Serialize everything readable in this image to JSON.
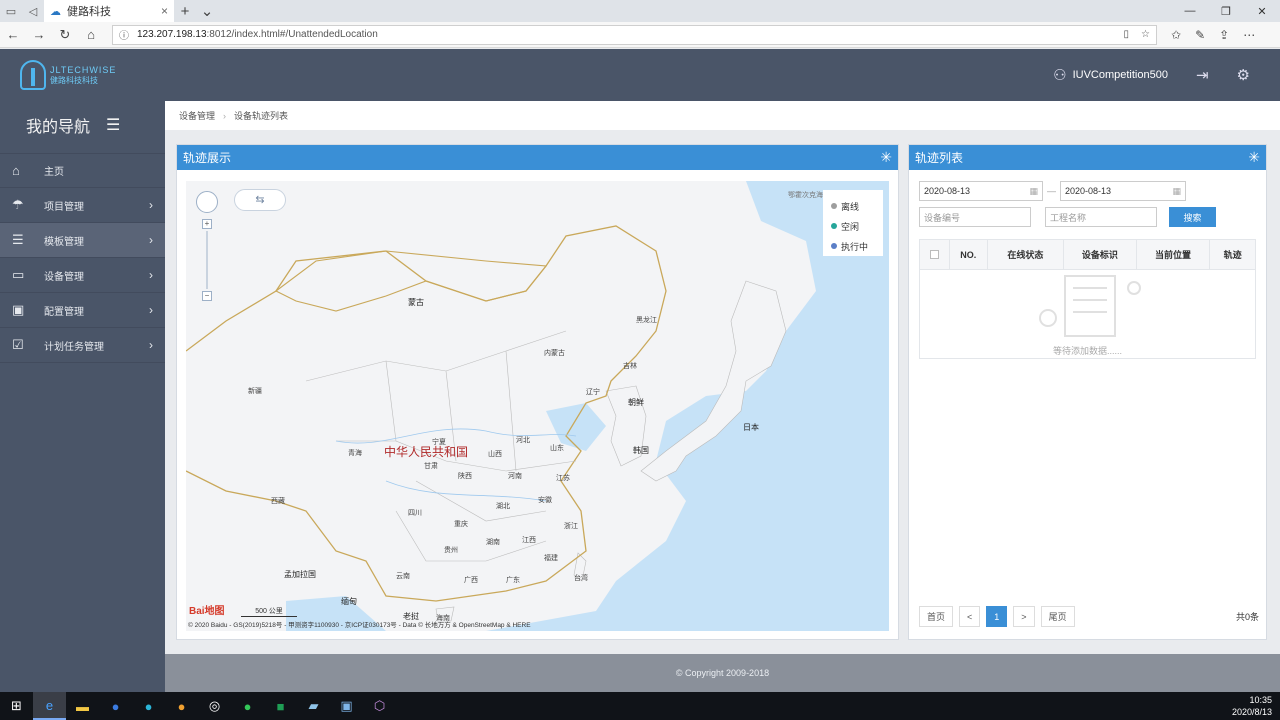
{
  "browser": {
    "tab_title": "健路科技",
    "url_host": "123.207.198.13",
    "url_rest": ":8012/index.html#/UnattendedLocation"
  },
  "header": {
    "logo_en": "JLTECHWISE",
    "logo_zh": "健路科技科技",
    "username": "IUVCompetition500"
  },
  "sidebar": {
    "title": "我的导航",
    "items": [
      {
        "label": "主页",
        "icon": "home-icon"
      },
      {
        "label": "项目管理",
        "icon": "project-icon"
      },
      {
        "label": "模板管理",
        "icon": "template-icon"
      },
      {
        "label": "设备管理",
        "icon": "device-icon"
      },
      {
        "label": "配置管理",
        "icon": "config-icon"
      },
      {
        "label": "计划任务管理",
        "icon": "task-icon"
      }
    ]
  },
  "breadcrumb": {
    "parent": "设备管理",
    "current": "设备轨迹列表"
  },
  "map_panel": {
    "title": "轨迹展示",
    "top_right_label": "鄂霍次克海",
    "legend": [
      {
        "label": "离线",
        "color": "#9e9e9e"
      },
      {
        "label": "空闲",
        "color": "#26a69a"
      },
      {
        "label": "执行中",
        "color": "#5b7fc7"
      }
    ],
    "labels": {
      "mongolia": "蒙古",
      "china": "中华人民共和国",
      "korea_n": "朝鲜",
      "korea_s": "韩国",
      "japan": "日本",
      "bangladesh": "孟加拉国",
      "myanmar": "缅甸",
      "laos": "老挝",
      "heilongjiang": "黑龙江",
      "jilin": "吉林",
      "liaoning": "辽宁",
      "neimenggu": "内蒙古",
      "xinjiang": "新疆",
      "xizang": "西藏",
      "qinghai": "青海",
      "gansu": "甘肃",
      "sichuan": "四川",
      "yunnan": "云南",
      "guangxi": "广西",
      "guangdong": "广东",
      "fujian": "福建",
      "taiwan": "台湾",
      "zhejiang": "浙江",
      "jiangxi": "江西",
      "hunan": "湖南",
      "guizhou": "贵州",
      "hubei": "湖北",
      "anhui": "安徽",
      "henan": "河南",
      "shandong": "山东",
      "hebei": "河北",
      "shanxi": "山西",
      "shaanxi": "陕西",
      "ningxia": "宁夏",
      "jiangsu": "江苏",
      "hainan": "海南",
      "chongqing": "重庆"
    },
    "scale_label": "500 公里",
    "baidu_label": "Bai地图",
    "copyright": "© 2020 Baidu - GS(2019)5218号 - 甲测资字1100930 - 京ICP证030173号 - Data © 长地万方 & OpenStreetMap & HERE"
  },
  "list_panel": {
    "title": "轨迹列表",
    "date_from": "2020-08-13",
    "date_to": "2020-08-13",
    "date_sep": "—",
    "device_placeholder": "设备编号",
    "project_placeholder": "工程名称",
    "search_label": "搜索",
    "columns": [
      "NO.",
      "在线状态",
      "设备标识",
      "当前位置",
      "轨迹"
    ],
    "empty_text": "等待添加数据......",
    "pager": {
      "first": "首页",
      "prev": "<",
      "page": "1",
      "next": ">",
      "last": "尾页",
      "total": "共0条"
    }
  },
  "footer": {
    "text": "© Copyright 2009-2018"
  },
  "taskbar": {
    "time": "10:35",
    "date": "2020/8/13"
  }
}
